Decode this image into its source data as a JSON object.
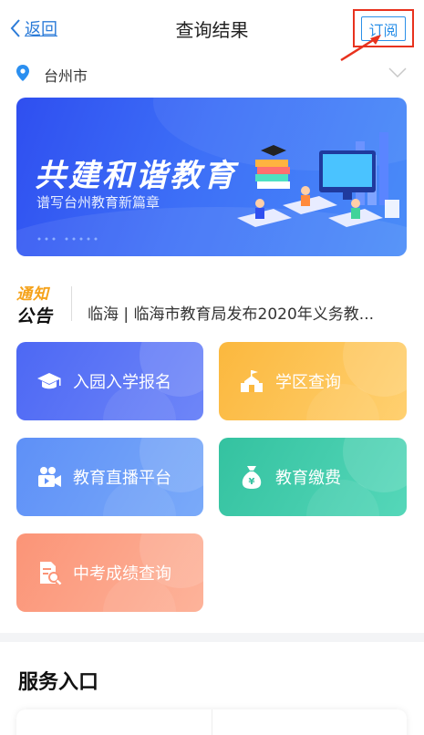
{
  "nav": {
    "back_label": "返回",
    "title": "查询结果",
    "subscribe_label": "订阅"
  },
  "location": {
    "city": "台州市"
  },
  "banner": {
    "title": "共建和谐教育",
    "subtitle": "谱写台州教育新篇章"
  },
  "notice": {
    "logo_line1": "通知",
    "logo_line2": "公告",
    "text": "临海 | 临海市教育局发布2020年义务教..."
  },
  "services": [
    {
      "label": "入园入学报名",
      "icon": "graduation-cap-icon"
    },
    {
      "label": "学区查询",
      "icon": "school-building-icon"
    },
    {
      "label": "教育直播平台",
      "icon": "video-camera-icon"
    },
    {
      "label": "教育缴费",
      "icon": "money-bag-icon"
    },
    {
      "label": "中考成绩查询",
      "icon": "document-search-icon"
    }
  ],
  "section": {
    "title": "服务入口"
  },
  "colors": {
    "accent": "#2b90e8",
    "highlight": "#e8321e"
  }
}
